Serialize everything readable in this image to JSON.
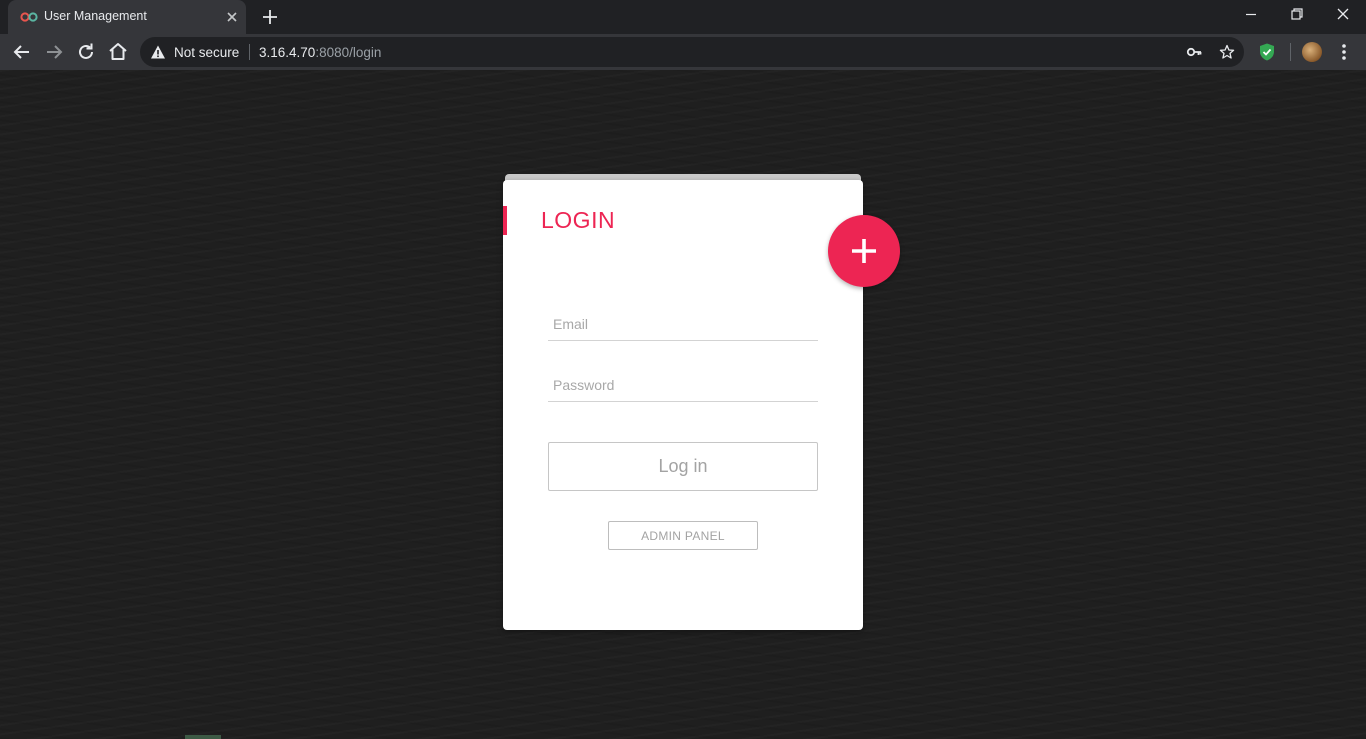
{
  "browser": {
    "tab": {
      "title": "User Management",
      "close_icon": "close-icon"
    },
    "address_bar": {
      "security_label": "Not secure",
      "url_host": "3.16.4.70",
      "url_rest": ":8080/login"
    }
  },
  "login_card": {
    "title": "LOGIN",
    "email_placeholder": "Email",
    "password_placeholder": "Password",
    "login_button": "Log in",
    "admin_button": "ADMIN PANEL",
    "fab_icon": "plus-icon"
  },
  "colors": {
    "accent": "#ed2553",
    "chrome_dark": "#202124",
    "chrome_toolbar": "#35363a",
    "page_background": "#1f1f1f"
  }
}
